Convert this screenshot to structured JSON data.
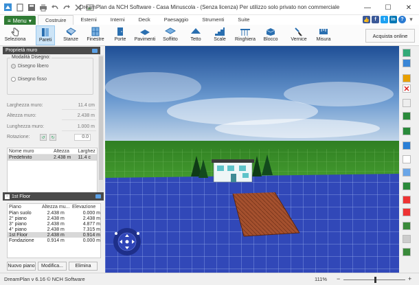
{
  "window": {
    "title": "DreamPlan da NCH Software - Casa Minuscola - (Senza licenza) Per utilizzo solo privato non commerciale",
    "minimize": "—",
    "maximize": "☐",
    "close": "✕"
  },
  "menubar": {
    "menu_label": "Menu",
    "tabs": [
      "Costruire",
      "Esterni",
      "Interni",
      "Deck",
      "Paesaggio",
      "Strumenti",
      "Suite"
    ]
  },
  "toolbar": {
    "items": [
      "Seleziona",
      "Pareti",
      "Stanze",
      "Finestre",
      "Porte",
      "Pavimenti",
      "Soffitto",
      "Tetto",
      "Scale",
      "Ringhiera",
      "Blocco",
      "Vernice",
      "Misura"
    ],
    "buy_label": "Acquista online"
  },
  "wall_properties": {
    "title": "Proprietà muro",
    "mode_label": "Modalità Disegno:",
    "mode_free": "Disegno libero",
    "mode_fixed": "Disegno fisso",
    "fields": [
      {
        "label": "Larghezza muro:",
        "value": "11.4 cm"
      },
      {
        "label": "Altezza muro:",
        "value": "2.438 m"
      },
      {
        "label": "Lunghezza muro:",
        "value": "1.000 m"
      }
    ],
    "rotation_label": "Rotazione:",
    "rotation_value": "0.0",
    "table_headers": [
      "Nome muro",
      "Altezza",
      "Larghez"
    ],
    "table_rows": [
      [
        "Predefinito",
        "2.438 m",
        "11.4 c"
      ]
    ]
  },
  "floor_panel": {
    "title": "1st Floor",
    "headers": [
      "Piano",
      "Altezza mu...",
      "Elevazione"
    ],
    "rows": [
      [
        "Pian suolo",
        "2.438 m",
        "0.000 m"
      ],
      [
        "2° piano",
        "2.438 m",
        "2.438 m"
      ],
      [
        "3° piano",
        "2.438 m",
        "4.877 m"
      ],
      [
        "4° piano",
        "2.438 m",
        "7.315 m"
      ],
      [
        "1st Floor",
        "2.438 m",
        "0.914 m"
      ],
      [
        "Fondazione",
        "0.914 m",
        "0.000 m"
      ]
    ],
    "selected_row": 4,
    "buttons": [
      "Nuovo piano",
      "Modifica...",
      "Elimina"
    ]
  },
  "statusbar": {
    "version": "DreamPlan v 6.16 © NCH Software",
    "zoom": "111%",
    "zoom_minus": "−",
    "zoom_plus": "+"
  },
  "colors": {
    "menu_green": "#2f7b34",
    "active_tab_blue": "#cce4f7",
    "panel_header": "#4a4a4a",
    "grass": "#3e9a2b",
    "water_grid": "#3a56c8",
    "deck": "#9c4a2c"
  }
}
